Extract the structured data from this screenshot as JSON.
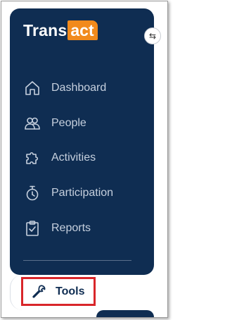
{
  "brand": {
    "prefix": "Trans",
    "suffix": "act"
  },
  "collapse": {
    "icon": "swap-arrows-icon",
    "glyph": "⇆"
  },
  "nav": {
    "items": [
      {
        "label": "Dashboard",
        "icon": "home-icon"
      },
      {
        "label": "People",
        "icon": "people-icon"
      },
      {
        "label": "Activities",
        "icon": "puzzle-icon"
      },
      {
        "label": "Participation",
        "icon": "stopwatch-icon"
      },
      {
        "label": "Reports",
        "icon": "clipboard-check-icon"
      }
    ],
    "active": {
      "label": "Tools",
      "icon": "wrench-icon"
    }
  },
  "colors": {
    "sidebar_bg": "#0f2d52",
    "brand_accent": "#f18a1c",
    "highlight_border": "#d9262a",
    "nav_text": "#c6d0de"
  }
}
